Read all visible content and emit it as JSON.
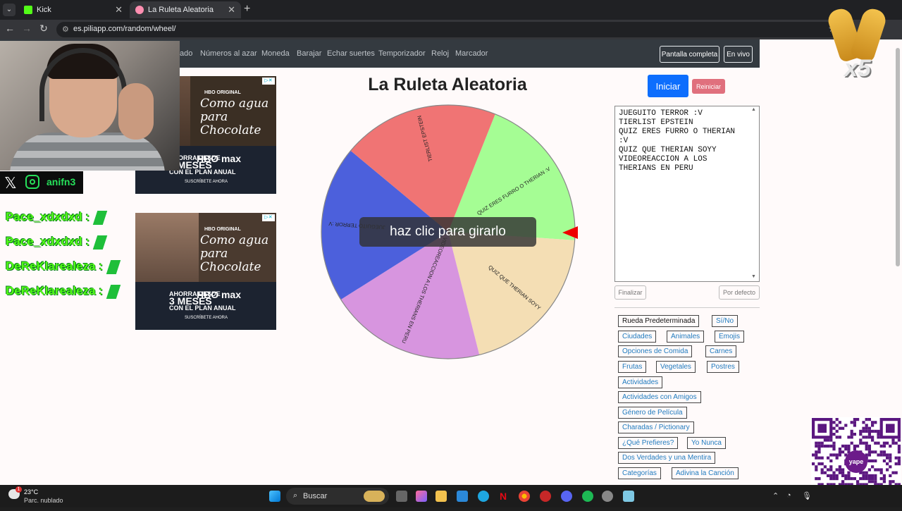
{
  "browser": {
    "tabs": [
      {
        "label": "Kick",
        "favicon_color": "#53fc18"
      },
      {
        "label": "La Ruleta Aleatoria",
        "favicon_color": "#ff8fb1"
      }
    ],
    "url": "es.piliapp.com/random/wheel/"
  },
  "site_nav": {
    "links": [
      "ado",
      "Números al azar",
      "Moneda",
      "Barajar",
      "Echar suertes",
      "Temporizador",
      "Reloj",
      "Marcador"
    ],
    "fullscreen_label": "Pantalla completa",
    "live_label": "En vivo"
  },
  "main": {
    "title": "La Ruleta Aleatoria",
    "start_label": "Iniciar",
    "reset_label": "Reiniciar",
    "spin_prompt": "haz clic para girarlo"
  },
  "wheel": {
    "segments": [
      {
        "label": "QUIZ ERES FURRO O THERIAN :V",
        "color": "#a5fd94"
      },
      {
        "label": "QUIZ QUE THERIAN SOYY",
        "color": "#f4deb4"
      },
      {
        "label": "VIDEOREACCION A LOS THERIANS EN PERU",
        "color": "#d795df"
      },
      {
        "label": "JUEGUITO TERROR :V",
        "color": "#4c60dc"
      },
      {
        "label": "TIERLIST EPSTEIN",
        "color": "#f07474"
      }
    ]
  },
  "entries": {
    "text": "JUEGUITO TERROR :V\nTIERLIST EPSTEIN\nQUIZ ERES FURRO O THERIAN\n:V\nQUIZ QUE THERIAN SOYY\nVIDEOREACCION A LOS\nTHERIANS EN PERU",
    "finish_label": "Finalizar",
    "default_label": "Por defecto"
  },
  "presets": [
    "Rueda Predeterminada",
    "Sí/No",
    "Ciudades",
    "Animales",
    "Emojis",
    "Opciones de Comida",
    "Carnes",
    "Frutas",
    "Vegetales",
    "Postres",
    "Actividades",
    "Actividades con Amigos",
    "Género de Película",
    "Charadas / Pictionary",
    "¿Qué Prefieres?",
    "Yo Nunca",
    "Dos Verdades y una Mentira",
    "Categorías",
    "Adivina la Canción"
  ],
  "ads": {
    "hbo_small": "HBO ORIGINAL",
    "headline": "Como agua para Chocolate",
    "promo_line1": "AHORRA DESDE",
    "promo_months": "3 MESES",
    "promo_line3": "CON EL PLAN ANUAL",
    "brand": "HBO max",
    "cta": "SUSCRÍBETE AHORA"
  },
  "overlay": {
    "social_handle": "anifn3",
    "chat": [
      "Pace_xdxdxd :",
      "Pace_xdxdxd :",
      "DeReKlarealeza :",
      "DeReKlarealeza :"
    ],
    "multiplier": "x5",
    "qr_label": "yape"
  },
  "taskbar": {
    "temperature": "23°C",
    "condition": "Parc. nublado",
    "search_placeholder": "Buscar",
    "badge": "1"
  }
}
